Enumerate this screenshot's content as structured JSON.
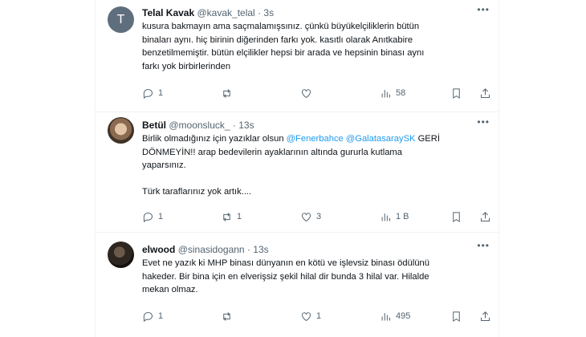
{
  "tweets": [
    {
      "avatar_letter": "T",
      "name": "Telal Kavak",
      "handle": "@kavak_telal",
      "sep": "·",
      "time": "3s",
      "lines": [
        "kusura bakmayın ama saçmalamışsınız. çünkü büyükelçiliklerin bütün",
        "binaları aynı. hiç birinin diğerinden farkı yok. kasıtlı olarak Anıtkabire",
        "benzetilmemiştir. bütün elçilikler hepsi bir arada ve hepsinin binası aynı",
        "farkı yok birbirlerinden"
      ],
      "replies": "1",
      "retweets": "",
      "likes": "",
      "views": "58"
    },
    {
      "name": "Betül",
      "handle": "@moonsluck_",
      "sep": "·",
      "time": "13s",
      "line1_pre": "Birlik olmadığınız için yazıklar olsun ",
      "mention1": "@Fenerbahce",
      "space": " ",
      "mention2": "@GalatasaraySK",
      "line1_post": " GERİ",
      "lines": [
        "DÖNMEYİN!! arap bedevilerin ayaklarının altında gururla kutlama",
        "yaparsınız.",
        "",
        "Türk taraflarınız yok artık...."
      ],
      "replies": "1",
      "retweets": "1",
      "likes": "3",
      "views": "1 B"
    },
    {
      "name": "elwood",
      "handle": "@sinasidogann",
      "sep": "·",
      "time": "13s",
      "lines": [
        "Evet ne yazık ki MHP binası dünyanın en kötü ve işlevsiz binası ödülünü",
        "hakeder. Bir bina için en elverişsiz şekil hilal dir bunda 3 hilal var. Hilalde",
        "mekan olmaz."
      ],
      "replies": "1",
      "retweets": "",
      "likes": "1",
      "views": "495"
    }
  ],
  "colors": {
    "text": "#0f1419",
    "secondary": "#536471",
    "mention": "#1d9bf0",
    "divider": "#eff3f4",
    "avatar_default": "#5f6e7d"
  }
}
